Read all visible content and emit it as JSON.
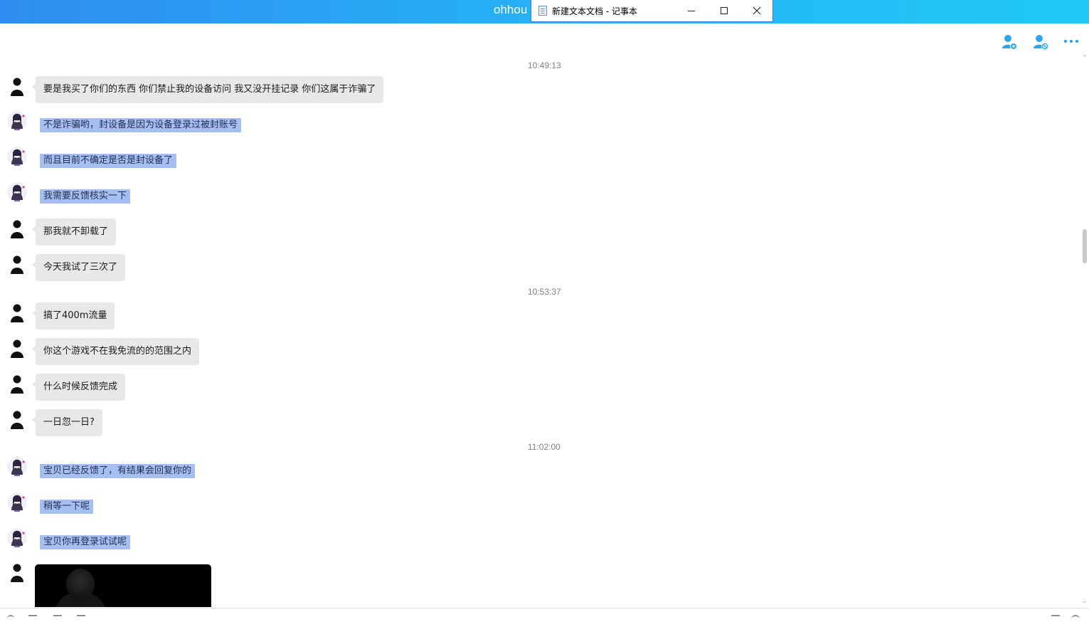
{
  "window": {
    "title": "ohhou"
  },
  "notepad": {
    "title": "新建文本文档 - 记事本",
    "minimize_icon": "minimize-icon",
    "maximize_icon": "maximize-icon",
    "close_icon": "close-icon"
  },
  "toolbar": {
    "icons": [
      "add-contact-icon",
      "block-contact-icon",
      "more-icon"
    ],
    "accent": "#2aa7f2"
  },
  "timestamps": [
    "10:49:13",
    "10:53:37",
    "11:02:00"
  ],
  "messages": [
    {
      "sender": "customer",
      "text": "要是我买了你们的东西 你们禁止我的设备访问 我又没开挂记录 你们这属于诈骗了"
    },
    {
      "sender": "agent",
      "text": "不是诈骗哟，封设备是因为设备登录过被封账号"
    },
    {
      "sender": "agent",
      "text": "而且目前不确定是否是封设备了"
    },
    {
      "sender": "agent",
      "text": "我需要反馈核实一下"
    },
    {
      "sender": "customer",
      "text": "那我就不卸载了"
    },
    {
      "sender": "customer",
      "text": "今天我试了三次了"
    },
    {
      "sender": "customer",
      "text": "搞了400m流量"
    },
    {
      "sender": "customer",
      "text": "你这个游戏不在我免流的的范围之内"
    },
    {
      "sender": "customer",
      "text": "什么时候反馈完成"
    },
    {
      "sender": "customer",
      "text": "一日忽一日?"
    },
    {
      "sender": "agent",
      "text": "宝贝已经反馈了，有结果会回复你的"
    },
    {
      "sender": "agent",
      "text": "稍等一下呢"
    },
    {
      "sender": "agent",
      "text": "宝贝你再登录试试呢"
    }
  ],
  "colors": {
    "customer_bubble": "#e8e8e8",
    "agent_selected_bubble": "#a6bff0",
    "title_gradient_start": "#2f8cf0",
    "title_gradient_end": "#1fc8f5"
  }
}
